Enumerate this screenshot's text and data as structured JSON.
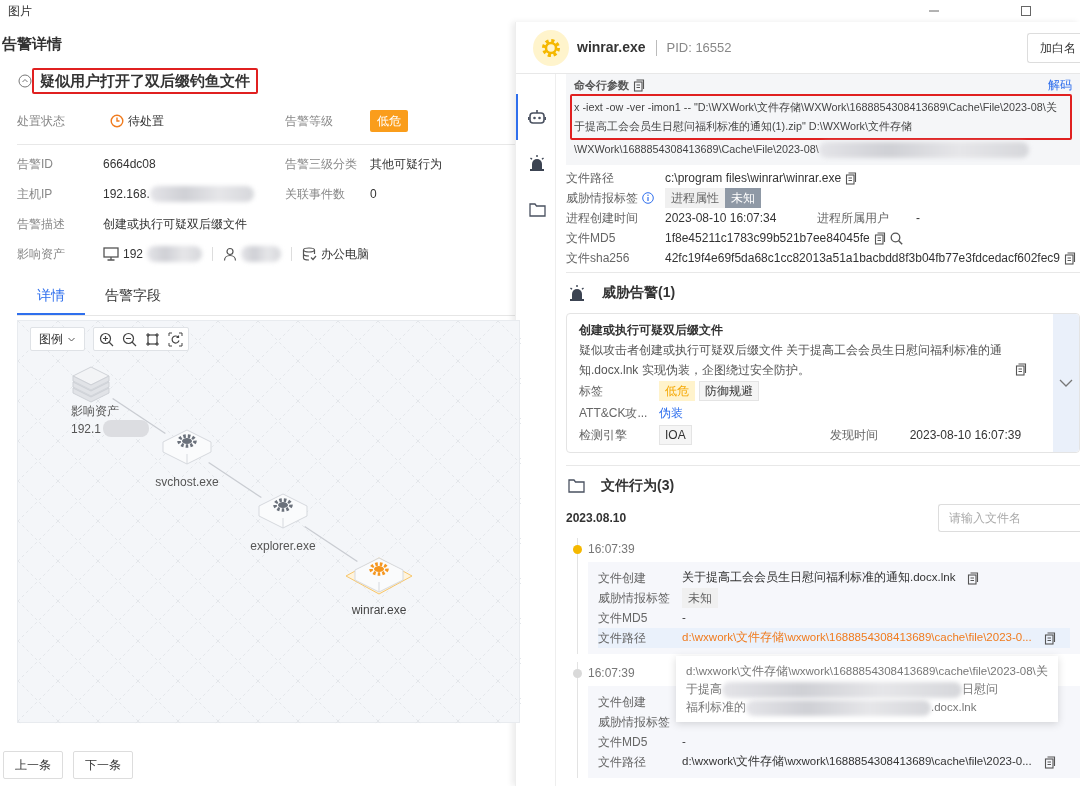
{
  "window": {
    "title": "图片"
  },
  "alert": {
    "heading": "告警详情",
    "title": {
      "text": "疑似用户打开了双后缀钓鱼文件",
      "highlighted": true
    },
    "status": {
      "label": "处置状态",
      "value": "待处置",
      "label2": "告警等级",
      "level": "低危"
    },
    "fields": [
      {
        "label": "告警ID",
        "value": "6664dc08",
        "label2": "告警三级分类",
        "value2": "其他可疑行为"
      },
      {
        "label": "主机IP",
        "value": "192.168.",
        "redacted": true,
        "label2": "关联事件数",
        "value2": "0"
      },
      {
        "label": "告警描述",
        "value": "创建或执行可疑双后缀文件"
      }
    ],
    "assets": {
      "label": "影响资产",
      "items": [
        {
          "kind": "host",
          "text": "192",
          "redacted": true
        },
        {
          "kind": "user",
          "redacted": true
        },
        {
          "kind": "type",
          "text": "办公电脑"
        }
      ]
    }
  },
  "tabs": [
    {
      "label": "详情",
      "selected": true
    },
    {
      "label": "告警字段",
      "selected": false
    }
  ],
  "graph": {
    "legend": "图例",
    "nodes": [
      {
        "kind": "asset",
        "label": "影响资产",
        "sublabel": "192.1",
        "selected": false
      },
      {
        "kind": "process",
        "label": "svchost.exe",
        "selected": false
      },
      {
        "kind": "process",
        "label": "explorer.exe",
        "selected": false
      },
      {
        "kind": "process",
        "label": "winrar.exe",
        "selected": true
      }
    ]
  },
  "pager": [
    "上一条",
    "下一条"
  ],
  "process": {
    "name": "winrar.exe",
    "pid": "PID: 16552",
    "button": "加白名"
  },
  "rail": [
    {
      "kind": "robot",
      "selected": true
    },
    {
      "kind": "alarm",
      "selected": false
    },
    {
      "kind": "folder",
      "selected": false
    }
  ],
  "cmdline": {
    "label": "命令行参数",
    "decode": "解码",
    "lines": [
      {
        "text": "x -iext -ow -ver -imon1 -- \"D:\\WXWork\\文件存储\\WXWork\\1688854308413689\\Cache\\File\\2023-08\\关",
        "highlighted": true
      },
      {
        "text": "于提高工会会员生日慰问福利标准的通知(1).zip\" D:\\WXWork\\文件存储",
        "highlighted": true
      },
      {
        "text": "\\WXWork\\1688854308413689\\Cache\\File\\2023-08\\",
        "highlighted": false,
        "redacted": true
      }
    ]
  },
  "info": [
    {
      "kind": "text",
      "label": "文件路径",
      "value": "c:\\program files\\winrar\\winrar.exe",
      "copy": true,
      "search": false
    },
    {
      "kind": "tags",
      "label": "威胁情报标签",
      "tags": [
        {
          "text": "进程属性",
          "kind": "attr"
        },
        {
          "text": "未知",
          "kind": "verdict"
        }
      ]
    },
    {
      "kind": "pair",
      "label": "进程创建时间",
      "value": "2023-08-10 16:07:34",
      "label2": "进程所属用户",
      "value2": "-"
    },
    {
      "kind": "text",
      "label": "文件MD5",
      "value": "1f8e45211c1783c99b521b7ee84045fe",
      "copy": true,
      "search": true
    },
    {
      "kind": "text",
      "label": "文件sha256",
      "value": "42fc19f4e69f5da68c1cc82013a51a1bacbdd8f3b04fb77e3fdcedacf602fec9",
      "copy": true,
      "search": false
    }
  ],
  "threats": {
    "title": "威胁告警(1)",
    "alerts": [
      {
        "name": "创建或执行可疑双后缀文件",
        "desc": "疑似攻击者创建或执行可疑双后缀文件 关于提高工会会员生日慰问福利标准的通知.docx.lnk 实现伪装，企图绕过安全防护。",
        "tags_label": "标签",
        "tags": [
          {
            "text": "低危",
            "kind": "level"
          },
          {
            "text": "防御规避",
            "kind": "plain"
          }
        ],
        "tactic_label": "ATT&CK攻...",
        "tactic": "伪装",
        "engine_label": "检测引擎",
        "engine": "IOA",
        "time_label": "发现时间",
        "time": "2023-08-10 16:07:39",
        "expanded": false
      }
    ]
  },
  "files": {
    "title": "文件行为(3)",
    "search": {
      "placeholder": "请输入文件名"
    },
    "date": "2023.08.10",
    "events": [
      {
        "time": "16:07:39",
        "color": "#f5b800",
        "fields": [
          {
            "kind": "text",
            "label": "文件创建",
            "value": "关于提高工会会员生日慰问福利标准的通知.docx.lnk",
            "copy": true,
            "hovered": false
          },
          {
            "kind": "tag",
            "label": "威胁情报标签",
            "value": "未知"
          },
          {
            "kind": "text",
            "label": "文件MD5",
            "value": "-",
            "copy": false,
            "hovered": false
          },
          {
            "kind": "text",
            "label": "文件路径",
            "value": "d:\\wxwork\\文件存储\\wxwork\\1688854308413689\\cache\\file\\2023-0...",
            "copy": true,
            "hovered": true
          }
        ]
      },
      {
        "time": "16:07:39",
        "color": "#d9d9d9",
        "fields": [
          {
            "kind": "label",
            "label": "文件创建"
          },
          {
            "kind": "label",
            "label": "威胁情报标签"
          },
          {
            "kind": "text",
            "label": "文件MD5",
            "value": "-",
            "copy": false,
            "hovered": false
          },
          {
            "kind": "text",
            "label": "文件路径",
            "value": "d:\\wxwork\\文件存储\\wxwork\\1688854308413689\\cache\\file\\2023-0...",
            "copy": true,
            "hovered": false
          }
        ]
      }
    ],
    "tooltip": {
      "lines": [
        [
          "d:\\wxwork\\文件存储\\wxwork\\1688854308413689\\cache\\file\\2023-08\\关"
        ],
        [
          "于提高",
          "日慰问"
        ],
        [
          "福利标准的",
          ".docx.lnk"
        ]
      ]
    }
  }
}
